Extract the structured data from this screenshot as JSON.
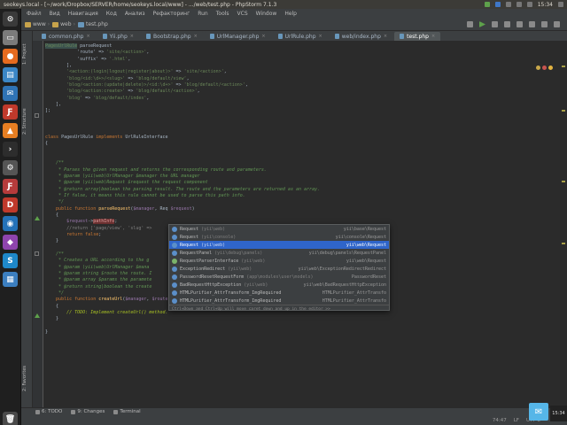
{
  "system_bar": {
    "title": "seokeys.local - [~/work/Dropbox/SERVER/home/seokeys.local/www] - .../web/test.php - PhpStorm 7.1.3",
    "clock": "15:34"
  },
  "menu": [
    "Файл",
    "Вид",
    "Навигация",
    "Код",
    "Анализ",
    "Рефакторинг",
    "Run",
    "Tools",
    "VCS",
    "Window",
    "Help"
  ],
  "breadcrumbs": [
    "www",
    "web",
    "test.php"
  ],
  "tabs": [
    {
      "label": "common.php",
      "active": false
    },
    {
      "label": "Yii.php",
      "active": false
    },
    {
      "label": "Bootstrap.php",
      "active": false
    },
    {
      "label": "UrlManager.php",
      "active": false
    },
    {
      "label": "UrlRule.php",
      "active": false
    },
    {
      "label": "web/index.php",
      "active": false
    },
    {
      "label": "test.php",
      "active": true
    }
  ],
  "side_tabs": [
    "1: Project",
    "2: Structure",
    "2: Favorites"
  ],
  "code_lines": [
    [
      {
        "t": "PagesUrlRule",
        "c": "hlstr"
      },
      {
        "t": " parseRequest",
        "c": "plain"
      }
    ],
    [
      {
        "t": "            'route' => ",
        "c": "plain"
      },
      {
        "t": "'site/<action>'",
        "c": "str"
      },
      {
        "t": ",",
        "c": "plain"
      }
    ],
    [
      {
        "t": "            'suffix' => ",
        "c": "plain"
      },
      {
        "t": "'.html'",
        "c": "str"
      },
      {
        "t": ",",
        "c": "plain"
      }
    ],
    [
      {
        "t": "        ],",
        "c": "plain"
      }
    ],
    [
      {
        "t": "        ",
        "c": "plain"
      },
      {
        "t": "'<action:(login|logout|register|about)>'",
        "c": "str"
      },
      {
        "t": " => ",
        "c": "plain"
      },
      {
        "t": "'site/<action>'",
        "c": "str"
      },
      {
        "t": ",",
        "c": "plain"
      }
    ],
    [
      {
        "t": "        ",
        "c": "plain"
      },
      {
        "t": "'blog/<id:\\d+>/<slug>'",
        "c": "str"
      },
      {
        "t": " => ",
        "c": "plain"
      },
      {
        "t": "'blog/default/view'",
        "c": "str"
      },
      {
        "t": ",",
        "c": "plain"
      }
    ],
    [
      {
        "t": "        ",
        "c": "plain"
      },
      {
        "t": "'blog/<action:(update|delete)>/<id:\\d+>'",
        "c": "str"
      },
      {
        "t": " => ",
        "c": "plain"
      },
      {
        "t": "'blog/default/<action>'",
        "c": "str"
      },
      {
        "t": ",",
        "c": "plain"
      }
    ],
    [
      {
        "t": "        ",
        "c": "plain"
      },
      {
        "t": "'blog/<action:create>'",
        "c": "str"
      },
      {
        "t": " => ",
        "c": "plain"
      },
      {
        "t": "'blog/default/<action>'",
        "c": "str"
      },
      {
        "t": ",",
        "c": "plain"
      }
    ],
    [
      {
        "t": "        ",
        "c": "plain"
      },
      {
        "t": "'blog'",
        "c": "str"
      },
      {
        "t": " => ",
        "c": "plain"
      },
      {
        "t": "'blog/default/index'",
        "c": "str"
      },
      {
        "t": ",",
        "c": "plain"
      }
    ],
    [
      {
        "t": "    ],",
        "c": "plain"
      }
    ],
    [
      {
        "t": "];",
        "c": "plain"
      }
    ],
    [],
    [],
    [],
    [
      {
        "t": "class ",
        "c": "kw"
      },
      {
        "t": "PagesUrlRule ",
        "c": "plain"
      },
      {
        "t": "implements ",
        "c": "kw"
      },
      {
        "t": "UrlRuleInterface",
        "c": "plain"
      }
    ],
    [
      {
        "t": "{",
        "c": "plain"
      }
    ],
    [],
    [],
    [
      {
        "t": "    /**",
        "c": "cm"
      }
    ],
    [
      {
        "t": "     * Parses the given request and returns the corresponding route and parameters.",
        "c": "cm"
      }
    ],
    [
      {
        "t": "     * @param \\yii\\web\\UrlManager $manager the URL manager",
        "c": "cm"
      }
    ],
    [
      {
        "t": "     * @param \\yii\\web\\Request $request the request component",
        "c": "cm"
      }
    ],
    [
      {
        "t": "     * @return array|boolean the parsing result. The route and the parameters are returned as an array.",
        "c": "cm"
      }
    ],
    [
      {
        "t": "     * If false, it means this rule cannot be used to parse this path info.",
        "c": "cm"
      }
    ],
    [
      {
        "t": "     */",
        "c": "cm"
      }
    ],
    [
      {
        "t": "    ",
        "c": "plain"
      },
      {
        "t": "public function ",
        "c": "kw"
      },
      {
        "t": "parseRequest",
        "c": "fn"
      },
      {
        "t": "(",
        "c": "plain"
      },
      {
        "t": "$manager",
        "c": "var"
      },
      {
        "t": ", Req ",
        "c": "plain"
      },
      {
        "t": "$request",
        "c": "var"
      },
      {
        "t": ")",
        "c": "plain"
      }
    ],
    [
      {
        "t": "    {",
        "c": "plain"
      }
    ],
    [
      {
        "t": "        ",
        "c": "plain"
      },
      {
        "t": "$request",
        "c": "var"
      },
      {
        "t": "->",
        "c": "plain"
      },
      {
        "t": "pathInfo",
        "c": "errhl"
      },
      {
        "t": ";",
        "c": "plain"
      }
    ],
    [
      {
        "t": "        //return ['page/view', 'slug' =>",
        "c": "cm2"
      }
    ],
    [
      {
        "t": "        ",
        "c": "plain"
      },
      {
        "t": "return false",
        "c": "kw"
      },
      {
        "t": ";",
        "c": "plain"
      }
    ],
    [
      {
        "t": "    }",
        "c": "plain"
      }
    ],
    [],
    [
      {
        "t": "    /**",
        "c": "cm"
      }
    ],
    [
      {
        "t": "     * Creates a URL according to the g",
        "c": "cm"
      }
    ],
    [
      {
        "t": "     * @param \\yii\\web\\UrlManager $mana",
        "c": "cm"
      }
    ],
    [
      {
        "t": "     * @param string $route the route. I",
        "c": "cm"
      }
    ],
    [
      {
        "t": "     * @param array $params the paramete",
        "c": "cm"
      }
    ],
    [
      {
        "t": "     * @return string|boolean the create",
        "c": "cm"
      }
    ],
    [
      {
        "t": "     */",
        "c": "cm"
      }
    ],
    [
      {
        "t": "    ",
        "c": "plain"
      },
      {
        "t": "public function ",
        "c": "kw"
      },
      {
        "t": "createUrl",
        "c": "fn"
      },
      {
        "t": "(",
        "c": "plain"
      },
      {
        "t": "$manager",
        "c": "var"
      },
      {
        "t": ", ",
        "c": "plain"
      },
      {
        "t": "$route",
        "c": "var"
      },
      {
        "t": ", ",
        "c": "plain"
      },
      {
        "t": "$params",
        "c": "var"
      },
      {
        "t": ")",
        "c": "plain"
      }
    ],
    [
      {
        "t": "    {",
        "c": "plain"
      }
    ],
    [
      {
        "t": "        // TODO: Implement createUrl() method.",
        "c": "todo"
      }
    ],
    [
      {
        "t": "    }",
        "c": "plain"
      }
    ],
    [],
    [
      {
        "t": "}",
        "c": "plain"
      }
    ]
  ],
  "completion_popup": {
    "items": [
      {
        "icon": "class",
        "name": "Request",
        "module": "(yii\\web)",
        "type": "yii\\base\\Request",
        "selected": false
      },
      {
        "icon": "class",
        "name": "Request",
        "module": "(yii\\console)",
        "type": "yii\\console\\Request",
        "selected": false
      },
      {
        "icon": "class",
        "name": "Request",
        "module": "(yii\\web)",
        "type": "yii\\web\\Request",
        "selected": true
      },
      {
        "icon": "class",
        "name": "RequestPanel",
        "module": "(yii\\debug\\panels)",
        "type": "yii\\debug\\panels\\RequestPanel",
        "selected": false
      },
      {
        "icon": "interface",
        "name": "RequestParserInterface",
        "module": "(yii\\web)",
        "type": "yii\\web\\Request",
        "selected": false
      },
      {
        "icon": "class",
        "name": "ExceptionRedirect",
        "module": "(yii\\web)",
        "type": "yii\\web\\ExceptionRedirectRedirect",
        "selected": false
      },
      {
        "icon": "class",
        "name": "PasswordResetRequestForm",
        "module": "(app\\modules\\user\\models)",
        "type": "PasswordReset",
        "selected": false
      },
      {
        "icon": "class",
        "name": "BadRequestHttpException",
        "module": "(yii\\web)",
        "type": "yii\\web\\BadRequestHttpException",
        "selected": false
      },
      {
        "icon": "class",
        "name": "HTMLPurifier_AttrTransform_ImgRequired",
        "module": "",
        "type": "HTMLPurifier_AttrTransfo",
        "selected": false
      },
      {
        "icon": "class",
        "name": "HTMLPurifier_AttrTransform_ImgRequired",
        "module": "",
        "type": "HTMLPurifier_AttrTransfo",
        "selected": false
      }
    ],
    "hint": "Ctrl+Down and Ctrl+Up will move caret down and up in the editor >>"
  },
  "bottom_tools": [
    {
      "label": "6: TODO",
      "icon": "todo-icon"
    },
    {
      "label": "9: Changes",
      "icon": "changes-icon"
    },
    {
      "label": "Terminal",
      "icon": "terminal-icon"
    }
  ],
  "status_bar": {
    "position": "74:47",
    "line_sep": "LF",
    "encoding": "UTF-8"
  },
  "colors": {
    "editor_bg": "#2b2b2b",
    "selection": "#2f65ca",
    "keyword": "#cc7832",
    "string": "#6a8759",
    "comment": "#629755"
  }
}
